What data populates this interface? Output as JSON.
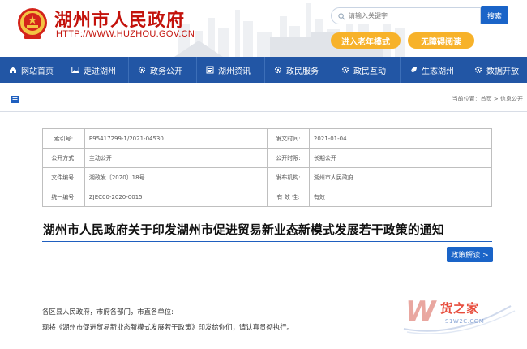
{
  "header": {
    "site_title": "湖州市人民政府",
    "site_url": "HTTP://WWW.HUZHOU.GOV.CN",
    "emblem_icon": "national-emblem-icon",
    "search_placeholder": "请输入关键字",
    "search_button": "搜索",
    "elder_mode": "进入老年模式",
    "accessible_reading": "无障碍阅读"
  },
  "nav": {
    "items": [
      {
        "label": "网站首页",
        "icon": "home-icon"
      },
      {
        "label": "走进湖州",
        "icon": "image-icon"
      },
      {
        "label": "政务公开",
        "icon": "gear-icon"
      },
      {
        "label": "湖州资讯",
        "icon": "news-icon"
      },
      {
        "label": "政民服务",
        "icon": "gear-icon"
      },
      {
        "label": "政民互动",
        "icon": "gear-icon"
      },
      {
        "label": "生态湖州",
        "icon": "leaf-icon"
      },
      {
        "label": "数据开放",
        "icon": "gear-icon"
      }
    ]
  },
  "breadcrumb": "当前位置：首页 > 信息公开",
  "meta": {
    "rows": [
      {
        "k1": "索引号:",
        "v1": "E95417299-1/2021-04530",
        "k2": "发文时间:",
        "v2": "2021-01-04"
      },
      {
        "k1": "公开方式:",
        "v1": "主动公开",
        "k2": "公开时限:",
        "v2": "长期公开"
      },
      {
        "k1": "文件编号:",
        "v1": "湖政发〔2020〕18号",
        "k2": "发布机构:",
        "v2": "湖州市人民政府"
      },
      {
        "k1": "统一编号:",
        "v1": "ZJEC00-2020-0015",
        "k2": "有 效 性:",
        "v2": "有效"
      }
    ]
  },
  "doc": {
    "title": "湖州市人民政府关于印发湖州市促进贸易新业态新模式发展若干政策的通知",
    "interpretation_button": "政策解读 >",
    "para1": "各区县人民政府，市府各部门，市直各单位:",
    "para2": "现将《湖州市促进贸易新业态新模式发展若干政策》印发给你们，请认真贯彻执行。"
  },
  "watermark": {
    "text": "货之家",
    "sub": "S1W2C.COM"
  }
}
